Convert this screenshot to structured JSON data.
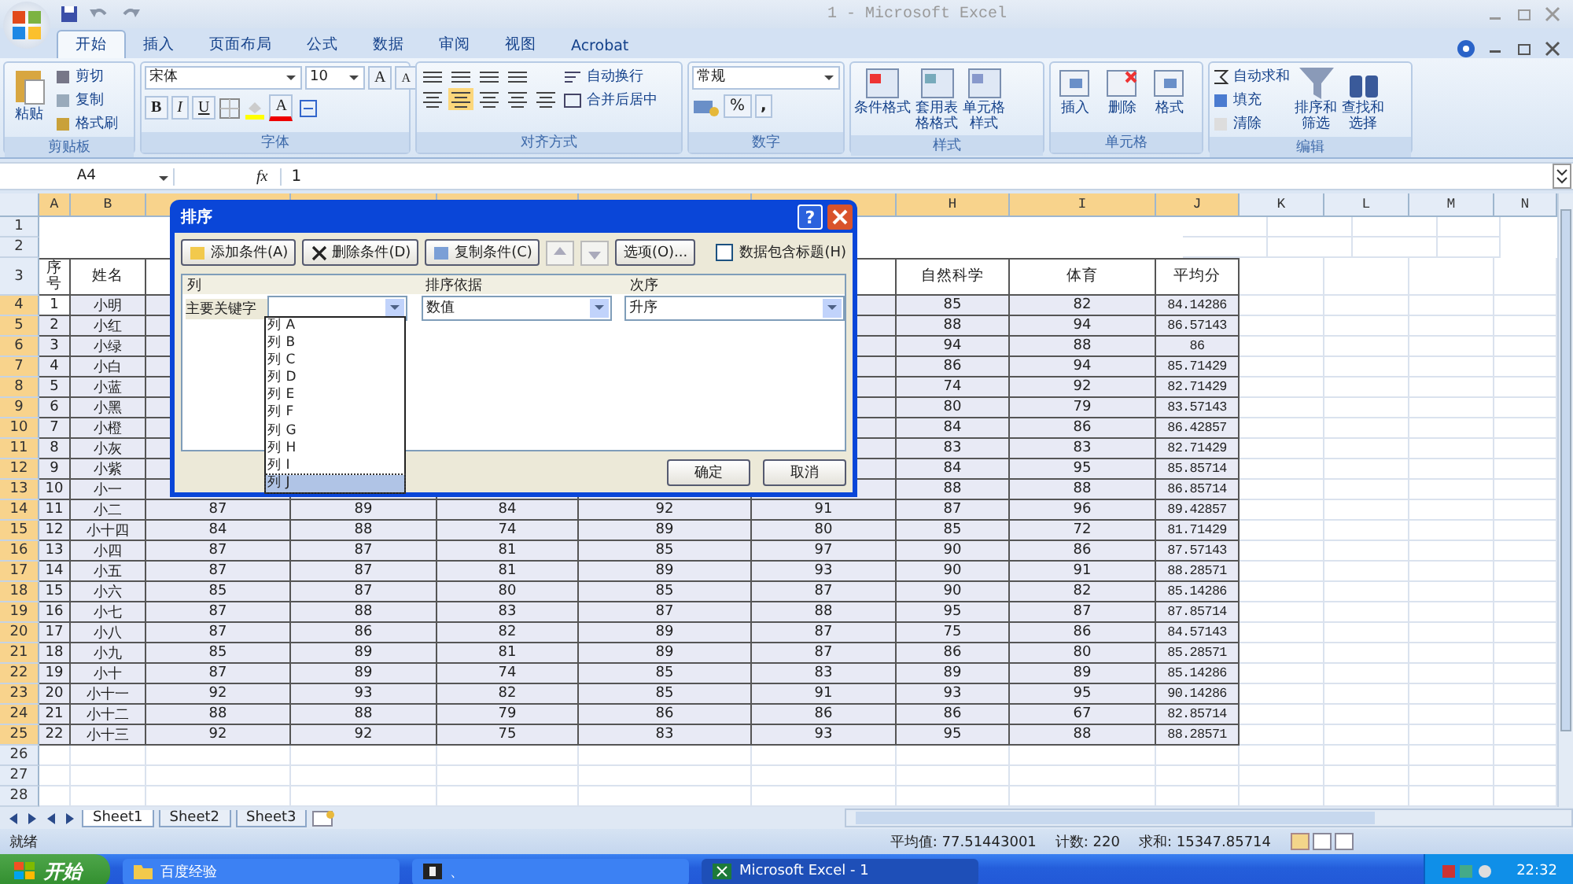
{
  "window": {
    "title": "1 - Microsoft Excel"
  },
  "tabs": [
    {
      "label": "开始",
      "selected": true
    },
    {
      "label": "插入",
      "selected": false
    },
    {
      "label": "页面布局",
      "selected": false
    },
    {
      "label": "公式",
      "selected": false
    },
    {
      "label": "数据",
      "selected": false
    },
    {
      "label": "审阅",
      "selected": false
    },
    {
      "label": "视图",
      "selected": false
    },
    {
      "label": "Acrobat",
      "selected": false
    }
  ],
  "ribbon": {
    "clipboard": {
      "label": "剪贴板",
      "paste": "粘贴",
      "items": [
        "剪切",
        "复制",
        "格式刷"
      ]
    },
    "font": {
      "label": "字体",
      "font_name": "宋体",
      "font_size": "10",
      "grow": "A",
      "shrink": "A",
      "bold": "B",
      "italic": "I",
      "underline": "U",
      "font_color": "A"
    },
    "alignment": {
      "label": "对齐方式",
      "wrap": "自动换行",
      "merge": "合并后居中"
    },
    "number": {
      "label": "数字",
      "format": "常规",
      "percent": "%",
      "comma": ","
    },
    "styles": {
      "label": "样式",
      "items": [
        "条件格式",
        "套用表格格式",
        "单元格样式"
      ]
    },
    "cells": {
      "label": "单元格",
      "items": [
        "插入",
        "删除",
        "格式"
      ]
    },
    "editing": {
      "label": "编辑",
      "small": [
        "自动求和",
        "填充",
        "清除"
      ],
      "big": [
        "排序和筛选",
        "查找和选择"
      ]
    }
  },
  "formula_bar": {
    "name_box": "A4",
    "fx": "fx",
    "value": "1"
  },
  "sheet": {
    "columns_left": [
      "A",
      "B"
    ],
    "columns_right": [
      "H",
      "I",
      "J",
      "K",
      "L",
      "M",
      "N"
    ],
    "row_numbers": [
      "1",
      "2",
      "3",
      "4",
      "5",
      "6",
      "7",
      "8",
      "9",
      "10",
      "11",
      "12",
      "13",
      "14",
      "15",
      "16",
      "17",
      "18",
      "19",
      "20",
      "21",
      "22",
      "23",
      "24",
      "25",
      "26",
      "27",
      "28"
    ],
    "header_left": [
      "序号",
      "姓名"
    ],
    "header_right": [
      "自然科学",
      "体育",
      "平均分"
    ],
    "rows": [
      {
        "no": "1",
        "name": "小明",
        "h": "85",
        "i": "82",
        "j": "84.14286"
      },
      {
        "no": "2",
        "name": "小红",
        "h": "88",
        "i": "94",
        "j": "86.57143"
      },
      {
        "no": "3",
        "name": "小绿",
        "h": "94",
        "i": "88",
        "j": "86"
      },
      {
        "no": "4",
        "name": "小白",
        "h": "86",
        "i": "94",
        "j": "85.71429"
      },
      {
        "no": "5",
        "name": "小蓝",
        "h": "74",
        "i": "92",
        "j": "82.71429"
      },
      {
        "no": "6",
        "name": "小黑",
        "h": "80",
        "i": "79",
        "j": "83.57143"
      },
      {
        "no": "7",
        "name": "小橙",
        "h": "84",
        "i": "86",
        "j": "86.42857"
      },
      {
        "no": "8",
        "name": "小灰",
        "h": "83",
        "i": "83",
        "j": "82.71429"
      },
      {
        "no": "9",
        "name": "小紫",
        "h": "84",
        "i": "95",
        "j": "85.85714"
      },
      {
        "no": "10",
        "name": "小一",
        "h": "88",
        "i": "88",
        "j": "86.85714"
      },
      {
        "no": "11",
        "name": "小二",
        "scores": [
          "87",
          "89",
          "84",
          "92",
          "91"
        ],
        "h": "87",
        "i": "96",
        "j": "89.42857"
      },
      {
        "no": "12",
        "name": "小十四",
        "scores": [
          "84",
          "88",
          "74",
          "89",
          "80"
        ],
        "h": "85",
        "i": "72",
        "j": "81.71429"
      },
      {
        "no": "13",
        "name": "小四",
        "scores": [
          "87",
          "87",
          "81",
          "85",
          "97"
        ],
        "h": "90",
        "i": "86",
        "j": "87.57143"
      },
      {
        "no": "14",
        "name": "小五",
        "scores": [
          "87",
          "87",
          "81",
          "89",
          "93"
        ],
        "h": "90",
        "i": "91",
        "j": "88.28571"
      },
      {
        "no": "15",
        "name": "小六",
        "scores": [
          "85",
          "87",
          "80",
          "85",
          "87"
        ],
        "h": "90",
        "i": "82",
        "j": "85.14286"
      },
      {
        "no": "16",
        "name": "小七",
        "scores": [
          "87",
          "88",
          "83",
          "87",
          "88"
        ],
        "h": "95",
        "i": "87",
        "j": "87.85714"
      },
      {
        "no": "17",
        "name": "小八",
        "scores": [
          "87",
          "86",
          "82",
          "89",
          "87"
        ],
        "h": "75",
        "i": "86",
        "j": "84.57143"
      },
      {
        "no": "18",
        "name": "小九",
        "scores": [
          "85",
          "89",
          "81",
          "89",
          "87"
        ],
        "h": "86",
        "i": "80",
        "j": "85.28571"
      },
      {
        "no": "19",
        "name": "小十",
        "scores": [
          "87",
          "89",
          "74",
          "85",
          "83"
        ],
        "h": "89",
        "i": "89",
        "j": "85.14286"
      },
      {
        "no": "20",
        "name": "小十一",
        "scores": [
          "92",
          "93",
          "82",
          "85",
          "91"
        ],
        "h": "93",
        "i": "95",
        "j": "90.14286"
      },
      {
        "no": "21",
        "name": "小十二",
        "scores": [
          "88",
          "88",
          "79",
          "86",
          "86"
        ],
        "h": "86",
        "i": "67",
        "j": "82.85714"
      },
      {
        "no": "22",
        "name": "小十三",
        "scores": [
          "92",
          "92",
          "75",
          "83",
          "93"
        ],
        "h": "95",
        "i": "88",
        "j": "88.28571"
      }
    ]
  },
  "sort_dialog": {
    "title": "排序",
    "help": "?",
    "toolbar": [
      "添加条件(A)",
      "删除条件(D)",
      "复制条件(C)"
    ],
    "options": "选项(O)...",
    "has_headers": {
      "label": "数据包含标题(H)",
      "checked": false
    },
    "headers": [
      "列",
      "排序依据",
      "次序"
    ],
    "level_label": "主要关键字",
    "sort_on": "数值",
    "order": "升序",
    "column_list": [
      {
        "label": "列 A",
        "selected": false
      },
      {
        "label": "列 B",
        "selected": false
      },
      {
        "label": "列 C",
        "selected": false
      },
      {
        "label": "列 D",
        "selected": false
      },
      {
        "label": "列 E",
        "selected": false
      },
      {
        "label": "列 F",
        "selected": false
      },
      {
        "label": "列 G",
        "selected": false
      },
      {
        "label": "列 H",
        "selected": false
      },
      {
        "label": "列 I",
        "selected": false
      },
      {
        "label": "列 J",
        "selected": true
      }
    ],
    "ok": "确定",
    "cancel": "取消"
  },
  "sheet_tabs": [
    {
      "label": "Sheet1",
      "selected": true
    },
    {
      "label": "Sheet2",
      "selected": false
    },
    {
      "label": "Sheet3",
      "selected": false
    }
  ],
  "status_bar": {
    "mode": "就绪",
    "average": "平均值: 77.51443001",
    "count": "计数: 220",
    "sum": "求和: 15347.85714"
  },
  "taskbar": {
    "start": "开始",
    "items": [
      {
        "label": "百度经验",
        "selected": false,
        "kind": "folder"
      },
      {
        "label": "、",
        "selected": false,
        "kind": "app"
      },
      {
        "label": "Microsoft Excel - 1",
        "selected": true,
        "kind": "excel"
      }
    ],
    "clock": "22:32"
  }
}
